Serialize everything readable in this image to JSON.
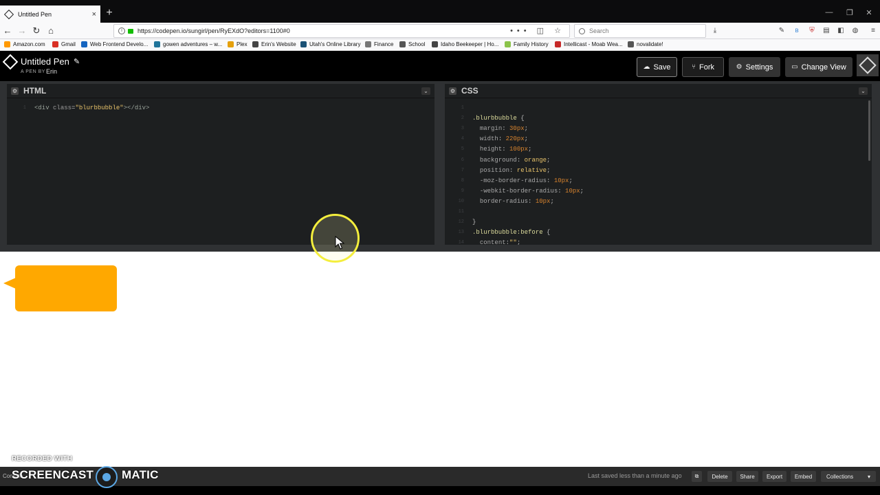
{
  "browser": {
    "tab_title": "Untitled Pen",
    "tab_close": "×",
    "new_tab": "+",
    "url": "https://codepen.io/sungirl/pen/RyEXdO?editors=1100#0",
    "search_placeholder": "Search",
    "url_actions": "•••"
  },
  "bookmarks": [
    {
      "label": "Amazon.com",
      "icon_color": "#ff9900"
    },
    {
      "label": "Gmail",
      "icon_color": "#d93025"
    },
    {
      "label": "Web Frontend Develo...",
      "icon_color": "#1565c0"
    },
    {
      "label": "gowen adventures – w...",
      "icon_color": "#21759b"
    },
    {
      "label": "Plex",
      "icon_color": "#e5a00d"
    },
    {
      "label": "Erin's Website",
      "icon_color": "#444444"
    },
    {
      "label": "Utah's Online Library",
      "icon_color": "#1a5276"
    },
    {
      "label": "Finance",
      "icon_color": "#777777"
    },
    {
      "label": "School",
      "icon_color": "#555555"
    },
    {
      "label": "Idaho Beekeeper | Ho...",
      "icon_color": "#444444"
    },
    {
      "label": "Family History",
      "icon_color": "#8bc34a"
    },
    {
      "label": "Intellicast - Moab Wea...",
      "icon_color": "#c62828"
    },
    {
      "label": "novalidate!",
      "icon_color": "#555555"
    }
  ],
  "codepen": {
    "pen_title": "Untitled Pen",
    "pen_by": "A PEN BY",
    "author": "Erin",
    "buttons": {
      "save": "Save",
      "fork": "Fork",
      "settings": "Settings",
      "change_view": "Change View"
    }
  },
  "editors": {
    "html": {
      "title": "HTML",
      "lines": [
        {
          "n": "1",
          "html": "<span class='c-tag'>&lt;div</span> <span class='c-attr'>class</span><span class='c-punc'>=</span><span class='c-str'>\"blurbbubble\"</span><span class='c-tag'>&gt;&lt;/div&gt;</span>"
        }
      ]
    },
    "css": {
      "title": "CSS",
      "lines": [
        {
          "n": "1",
          "html": ""
        },
        {
          "n": "2",
          "html": "<span class='c-sel'>.blurbbubble</span> <span class='c-punc'>{</span>"
        },
        {
          "n": "3",
          "html": "  <span class='c-prop'>margin</span><span class='c-punc'>:</span> <span class='c-num'>30px</span><span class='c-punc'>;</span>"
        },
        {
          "n": "4",
          "html": "  <span class='c-prop'>width</span><span class='c-punc'>:</span> <span class='c-num'>220px</span><span class='c-punc'>;</span>"
        },
        {
          "n": "5",
          "html": "  <span class='c-prop'>height</span><span class='c-punc'>:</span> <span class='c-num'>100px</span><span class='c-punc'>;</span>"
        },
        {
          "n": "6",
          "html": "  <span class='c-prop'>background</span><span class='c-punc'>:</span> <span class='c-str'>orange</span><span class='c-punc'>;</span>"
        },
        {
          "n": "7",
          "html": "  <span class='c-prop'>position</span><span class='c-punc'>:</span> <span class='c-str'>relative</span><span class='c-punc'>;</span>"
        },
        {
          "n": "8",
          "html": "  <span class='c-prop'>-moz-border-radius</span><span class='c-punc'>:</span> <span class='c-num'>10px</span><span class='c-punc'>;</span>"
        },
        {
          "n": "9",
          "html": "  <span class='c-prop'>-webkit-border-radius</span><span class='c-punc'>:</span> <span class='c-num'>10px</span><span class='c-punc'>;</span>"
        },
        {
          "n": "10",
          "html": "  <span class='c-prop'>border-radius</span><span class='c-punc'>:</span> <span class='c-num'>10px</span><span class='c-punc'>;</span>"
        },
        {
          "n": "11",
          "html": ""
        },
        {
          "n": "12",
          "html": "<span class='c-punc'>}</span>"
        },
        {
          "n": "13",
          "html": "<span class='c-sel'>.blurbbubble:before</span> <span class='c-punc'>{</span>"
        },
        {
          "n": "14",
          "html": "  <span class='c-prop'>content</span><span class='c-punc'>:</span><span class='c-str'>\"\"</span><span class='c-punc'>;</span>"
        }
      ]
    }
  },
  "preview": {
    "bubble_color": "#ffa800"
  },
  "footer": {
    "console": "Console",
    "saved_text": "Last saved less than a minute ago",
    "buttons": {
      "delete": "Delete",
      "share": "Share",
      "export": "Export",
      "embed": "Embed",
      "collections": "Collections"
    }
  },
  "watermark": {
    "top": "RECORDED WITH",
    "left": "SCREENCAST",
    "right": "MATIC"
  }
}
